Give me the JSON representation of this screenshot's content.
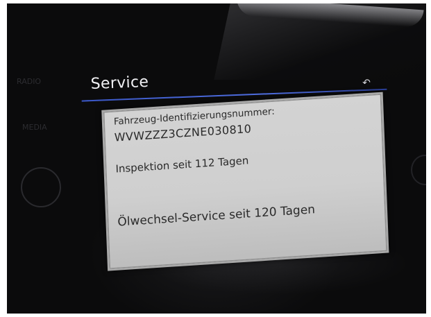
{
  "screen": {
    "title": "Service",
    "back_icon": "back-arrow-icon",
    "accent_color": "#3b58c8",
    "panel": {
      "vin_label": "Fahrzeug-Identifizierungsnummer:",
      "vin_value": "WVWZZZ3CZNE030810",
      "inspection_text": "Inspektion seit 112 Tagen",
      "oil_service_text": "Ölwechsel-Service seit 120 Tagen"
    }
  },
  "side_menu": {
    "radio_label": "RADIO",
    "media_label": "MEDIA"
  }
}
